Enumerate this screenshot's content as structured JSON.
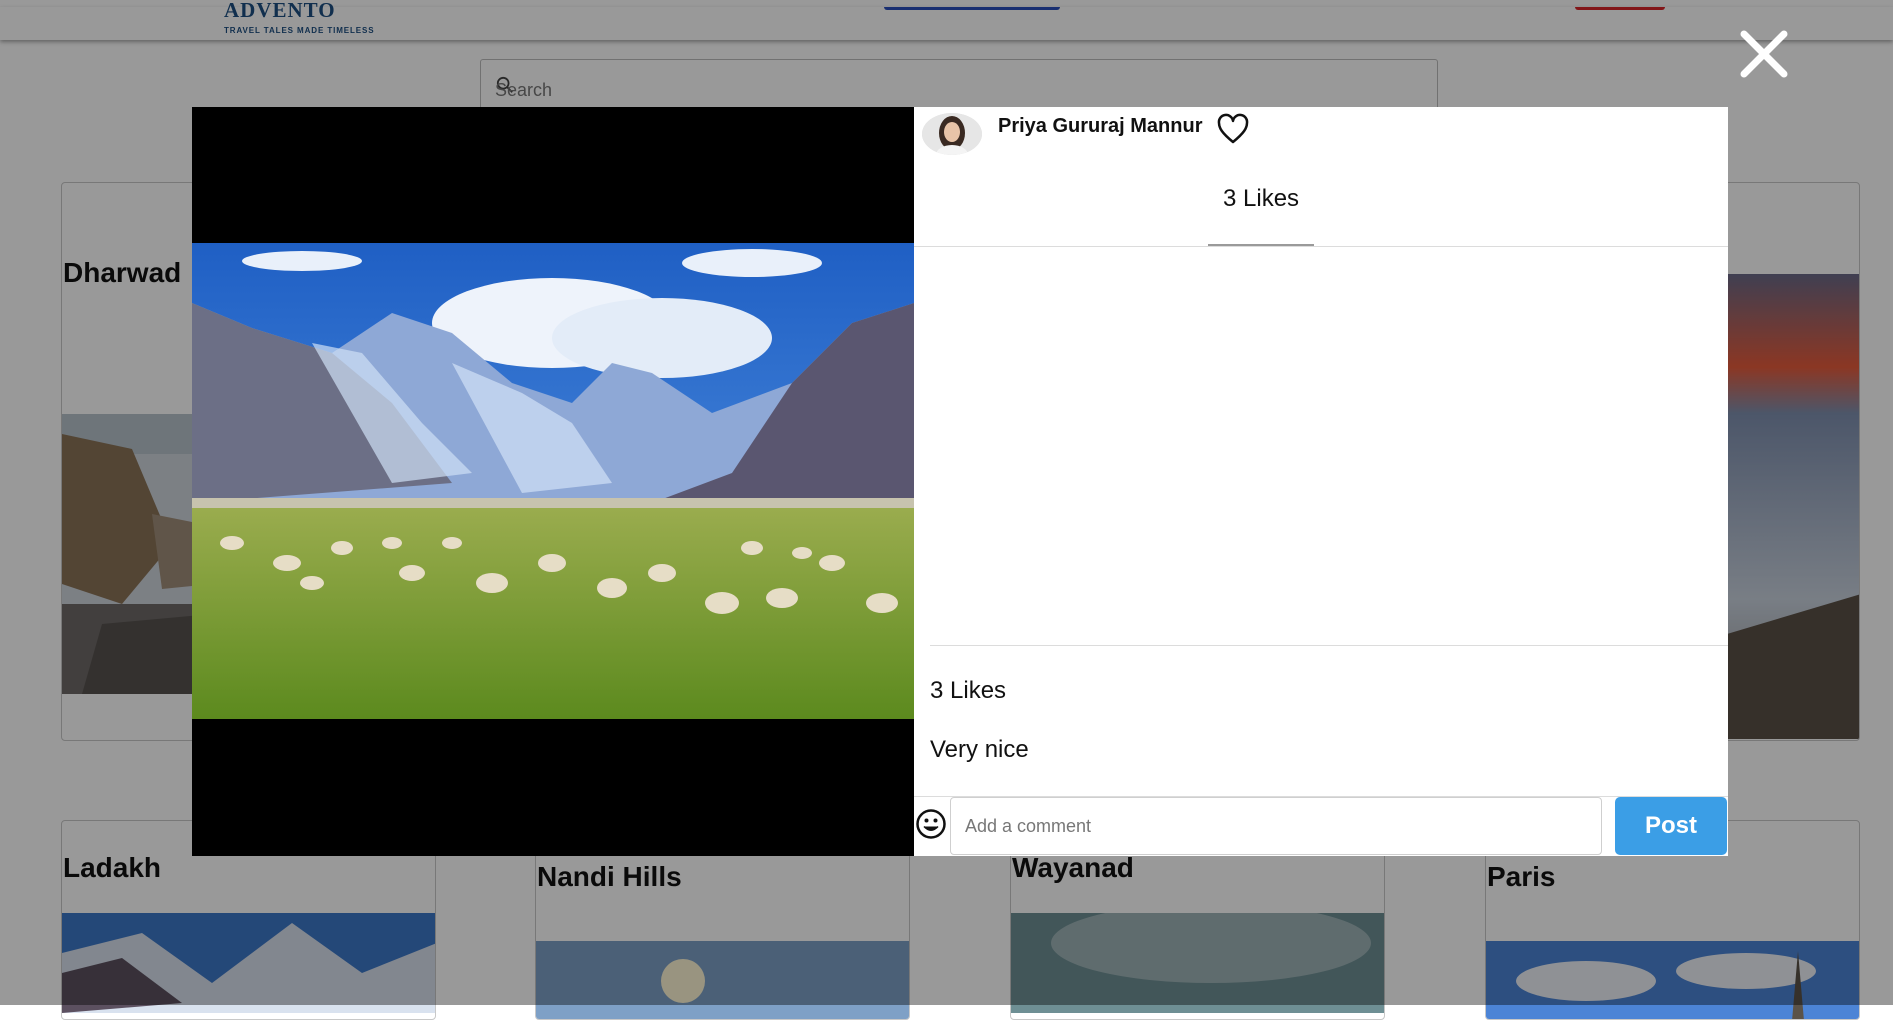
{
  "header": {
    "logo_text": "ADVENTO",
    "logo_tagline": "TRAVEL TALES MADE TIMELESS"
  },
  "search": {
    "placeholder": "Search"
  },
  "cards": [
    {
      "title": "Dharwad"
    },
    {
      "title": "Ladakh"
    },
    {
      "title": "Nandi Hills"
    },
    {
      "title": "Wayanad"
    },
    {
      "title": "Paris"
    }
  ],
  "modal": {
    "author": "Priya Gururaj Mannur",
    "likes_header": "3 Likes",
    "likes_footer": "3 Likes",
    "comments": [
      {
        "text": "Very nice"
      }
    ],
    "comment_placeholder": "Add a comment",
    "post_label": "Post"
  },
  "icons": {
    "close": "close-icon",
    "like": "heart-icon",
    "emoji": "smiley-icon",
    "search": "search-icon"
  },
  "colors": {
    "post_button": "#3b9ee6",
    "overlay": "rgba(0,0,0,0.40)",
    "brand": "#1d4f82"
  }
}
